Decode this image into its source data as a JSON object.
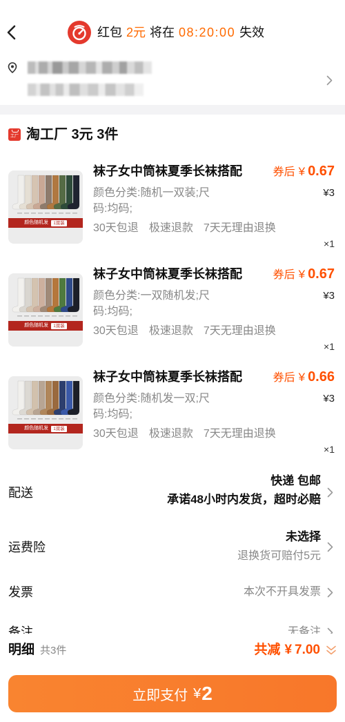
{
  "header": {
    "back_icon": "chevron-left-icon",
    "promo_icon": "red-packet-timer-icon",
    "promo": {
      "prefix": "红包",
      "amount": "2元",
      "middle": "将在",
      "countdown": "08:20:00",
      "suffix": "失效"
    }
  },
  "address": {
    "icon": "location-pin-icon",
    "chevron_icon": "chevron-right-icon"
  },
  "store": {
    "badge": "工厂",
    "title": "淘工厂 3元 3件"
  },
  "items": [
    {
      "title": "袜子女中筒袜夏季长袜搭配",
      "coupon_label": "券后",
      "currency": "¥",
      "coupon_price": "0.67",
      "spec": "颜色分类:随机一双装;尺码:均码;",
      "price": "¥3",
      "services": [
        "30天包退",
        "极速退款",
        "7天无理由退换"
      ],
      "quantity": "×1",
      "image_band": "颜色随机发",
      "image_tag": "1双装",
      "sock_colors": [
        "#f0efec",
        "#e5dfd4",
        "#d6c4b2",
        "#c9a895",
        "#8e7b6c",
        "#b07840",
        "#556b45",
        "#2e4b3a",
        "#1f2330"
      ]
    },
    {
      "title": "袜子女中筒袜夏季长袜搭配",
      "coupon_label": "券后",
      "currency": "¥",
      "coupon_price": "0.67",
      "spec": "颜色分类:一双随机发;尺码:均码;",
      "price": "¥3",
      "services": [
        "30天包退",
        "极速退款",
        "7天无理由退换"
      ],
      "quantity": "×1",
      "image_band": "颜色随机发",
      "image_tag": "1双装",
      "sock_colors": [
        "#f2f1ee",
        "#d9d6d0",
        "#d4c3b0",
        "#cdb09e",
        "#a08a78",
        "#b5773c",
        "#4f7a3f",
        "#2f4b8a",
        "#1c1f28"
      ]
    },
    {
      "title": "袜子女中筒袜夏季长袜搭配",
      "coupon_label": "券后",
      "currency": "¥",
      "coupon_price": "0.66",
      "spec": "颜色分类:随机发一双;尺码:均码;",
      "price": "¥3",
      "services": [
        "30天包退",
        "极速退款",
        "7天无理由退换"
      ],
      "quantity": "×1",
      "image_band": "颜色随机发",
      "image_tag": "1双装",
      "sock_colors": [
        "#f1f0ed",
        "#dcd9d3",
        "#d2c1ad",
        "#b8a593",
        "#b0865a",
        "#9a6a3e",
        "#2d3f6e",
        "#3a59a8",
        "#1c1f28"
      ]
    }
  ],
  "delivery": {
    "label": "配送",
    "method": "快递 包邮",
    "promise": "承诺48小时内发货，超时必赔"
  },
  "shipping_insurance": {
    "label": "运费险",
    "status": "未选择",
    "note": "退换货可赔付5元"
  },
  "invoice": {
    "label": "发票",
    "value": "本次不开具发票"
  },
  "remark": {
    "label": "备注",
    "value": "无备注"
  },
  "summary": {
    "detail_label": "明细",
    "count": "共3件",
    "discount_label": "共减",
    "currency": "¥",
    "discount": "7.00",
    "expand_icon": "double-chevron-down-icon"
  },
  "pay_button": {
    "label": "立即支付",
    "currency": "¥",
    "amount": "2"
  },
  "colors": {
    "accent": "#ff5000",
    "promo": "#ff6a00",
    "badge_red": "#e4392d",
    "button": "#f8772a",
    "band_red": "#b3261e"
  }
}
